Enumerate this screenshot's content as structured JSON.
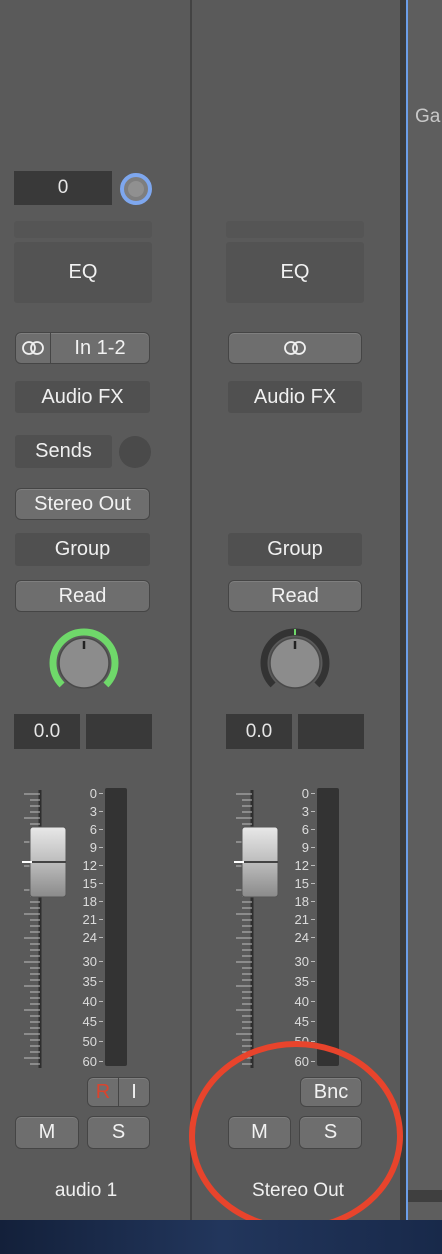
{
  "right_pane": {
    "label": "Ga"
  },
  "strips": [
    {
      "input_gain_value": "0",
      "eq_label": "EQ",
      "input_label": "In 1-2",
      "audio_fx_label": "Audio FX",
      "sends_label": "Sends",
      "output_label": "Stereo Out",
      "group_label": "Group",
      "automation_label": "Read",
      "volume_value": "0.0",
      "peak_value": "",
      "scale_ticks": [
        "0",
        "3",
        "6",
        "9",
        "12",
        "15",
        "18",
        "21",
        "24",
        "30",
        "35",
        "40",
        "45",
        "50",
        "60"
      ],
      "record_label": "R",
      "input_monitor_label": "I",
      "mute_label": "M",
      "solo_label": "S",
      "name": "audio 1",
      "pan_ring_color": "#6fd86a"
    },
    {
      "eq_label": "EQ",
      "audio_fx_label": "Audio FX",
      "group_label": "Group",
      "automation_label": "Read",
      "volume_value": "0.0",
      "peak_value": "",
      "scale_ticks": [
        "0",
        "3",
        "6",
        "9",
        "12",
        "15",
        "18",
        "21",
        "24",
        "30",
        "35",
        "40",
        "45",
        "50",
        "60"
      ],
      "bounce_label": "Bnc",
      "mute_label": "M",
      "solo_label": "S",
      "name": "Stereo Out",
      "pan_ring_color": "#6fd86a"
    }
  ],
  "annotation": {
    "color": "#e8442c"
  }
}
